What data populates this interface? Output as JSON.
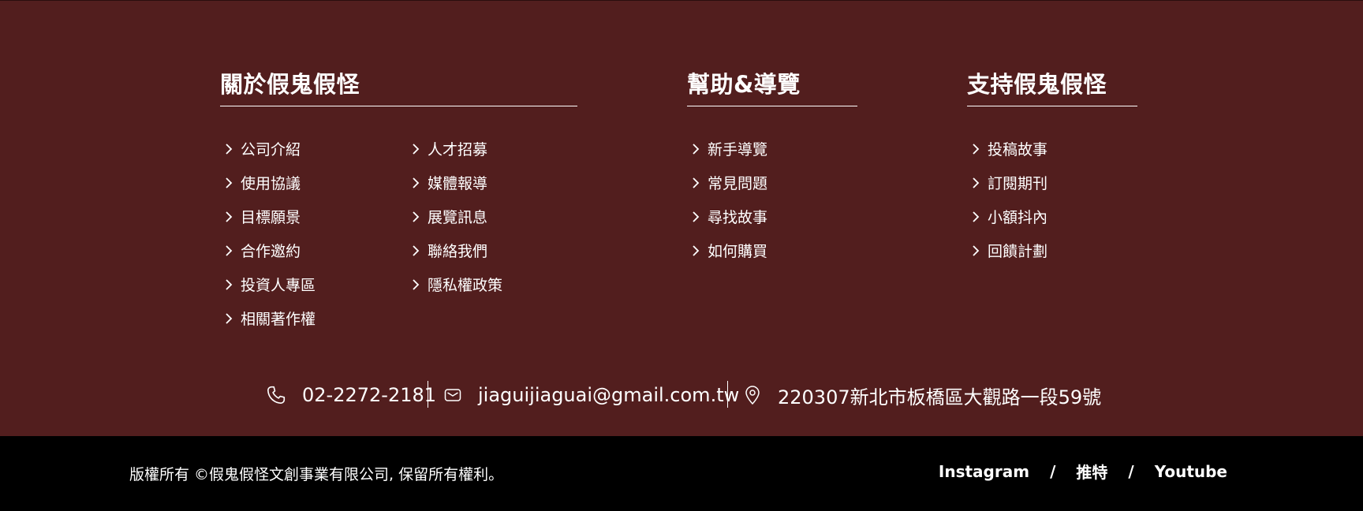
{
  "about": {
    "title": "關於假鬼假怪",
    "col1": [
      "公司介紹",
      "使用協議",
      "目標願景",
      "合作邀約",
      "投資人專區",
      "相關著作權"
    ],
    "col2": [
      "人才招募",
      "媒體報導",
      "展覽訊息",
      "聯絡我們",
      "隱私權政策"
    ]
  },
  "help": {
    "title": "幫助&導覽",
    "items": [
      "新手導覽",
      "常見問題",
      "尋找故事",
      "如何購買"
    ]
  },
  "support": {
    "title": "支持假鬼假怪",
    "items": [
      "投稿故事",
      "訂閱期刊",
      "小額抖內",
      "回饋計劃"
    ]
  },
  "contact": {
    "phone": "02-2272-2181",
    "email": "jiaguijiaguai@gmail.com.tw",
    "address": "220307新北市板橋區大觀路一段59號"
  },
  "bottom": {
    "copyright": "版權所有 ©假鬼假怪文創事業有限公司, 保留所有權利。",
    "social": [
      "Instagram",
      "推特",
      "Youtube"
    ],
    "separator": "/"
  },
  "colors": {
    "footer_bg": "#521e1e",
    "bottom_bg": "#000000",
    "text": "#ffffff"
  },
  "icons": [
    "chevron-right-icon",
    "phone-icon",
    "mail-icon",
    "location-pin-icon"
  ]
}
